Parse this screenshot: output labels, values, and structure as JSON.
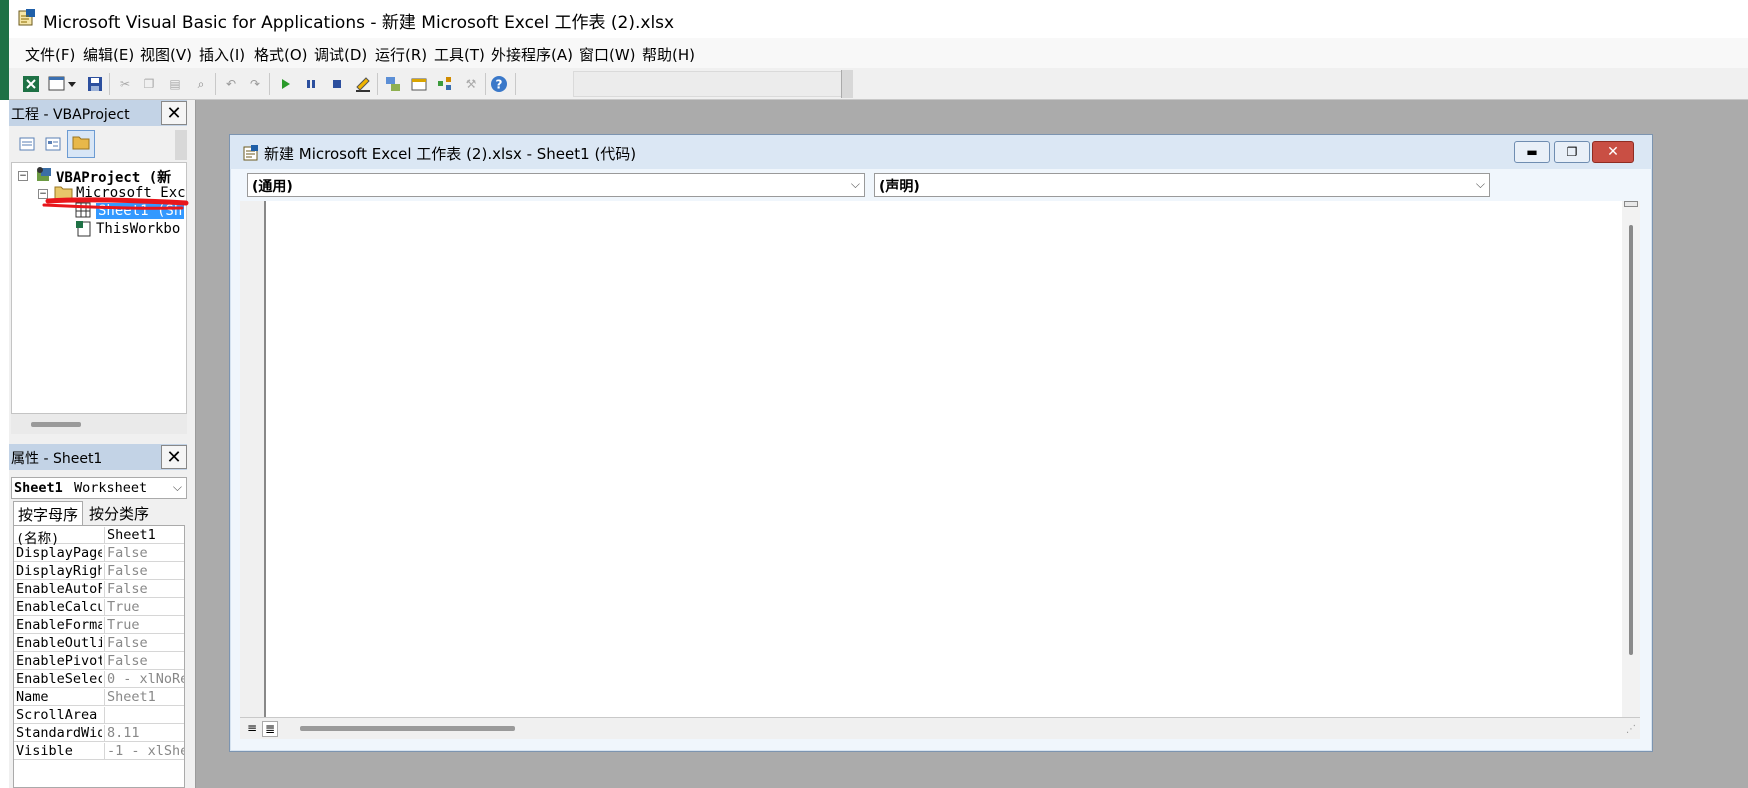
{
  "window": {
    "title": "Microsoft Visual Basic for Applications - 新建 Microsoft Excel 工作表 (2).xlsx"
  },
  "menu": [
    "文件(F)",
    "编辑(E)",
    "视图(V)",
    "插入(I)",
    "格式(O)",
    "调试(D)",
    "运行(R)",
    "工具(T)",
    "外接程序(A)",
    "窗口(W)",
    "帮助(H)"
  ],
  "project": {
    "header": "工程 - VBAProject",
    "tree": {
      "root": "VBAProject (新",
      "folder": "Microsoft Exc",
      "sheet": "Sheet1 (Sh",
      "workbook": "ThisWorkbo"
    }
  },
  "properties": {
    "header": "属性 - Sheet1",
    "object_name": "Sheet1",
    "object_type": "Worksheet",
    "tabs": [
      "按字母序",
      "按分类序"
    ],
    "rows": [
      {
        "name": "(名称)",
        "value": "Sheet1"
      },
      {
        "name": "DisplayPage",
        "value": "False"
      },
      {
        "name": "DisplayRigh",
        "value": "False"
      },
      {
        "name": "EnableAutoF",
        "value": "False"
      },
      {
        "name": "EnableCalcu",
        "value": "True"
      },
      {
        "name": "EnableForma",
        "value": "True"
      },
      {
        "name": "EnableOutli",
        "value": "False"
      },
      {
        "name": "EnablePivot",
        "value": "False"
      },
      {
        "name": "EnableSelec",
        "value": "0 - xlNoRe"
      },
      {
        "name": "Name",
        "value": "Sheet1"
      },
      {
        "name": "ScrollArea",
        "value": ""
      },
      {
        "name": "StandardWid",
        "value": "8.11"
      },
      {
        "name": "Visible",
        "value": "-1 - xlShe"
      }
    ]
  },
  "code_window": {
    "title": "新建 Microsoft Excel 工作表 (2).xlsx - Sheet1 (代码)",
    "object_combo": "(通用)",
    "proc_combo": "(声明)"
  },
  "colors": {
    "selection": "#3399ff",
    "annotation": "#e8161b",
    "pane_header": "#c3d3e6"
  }
}
